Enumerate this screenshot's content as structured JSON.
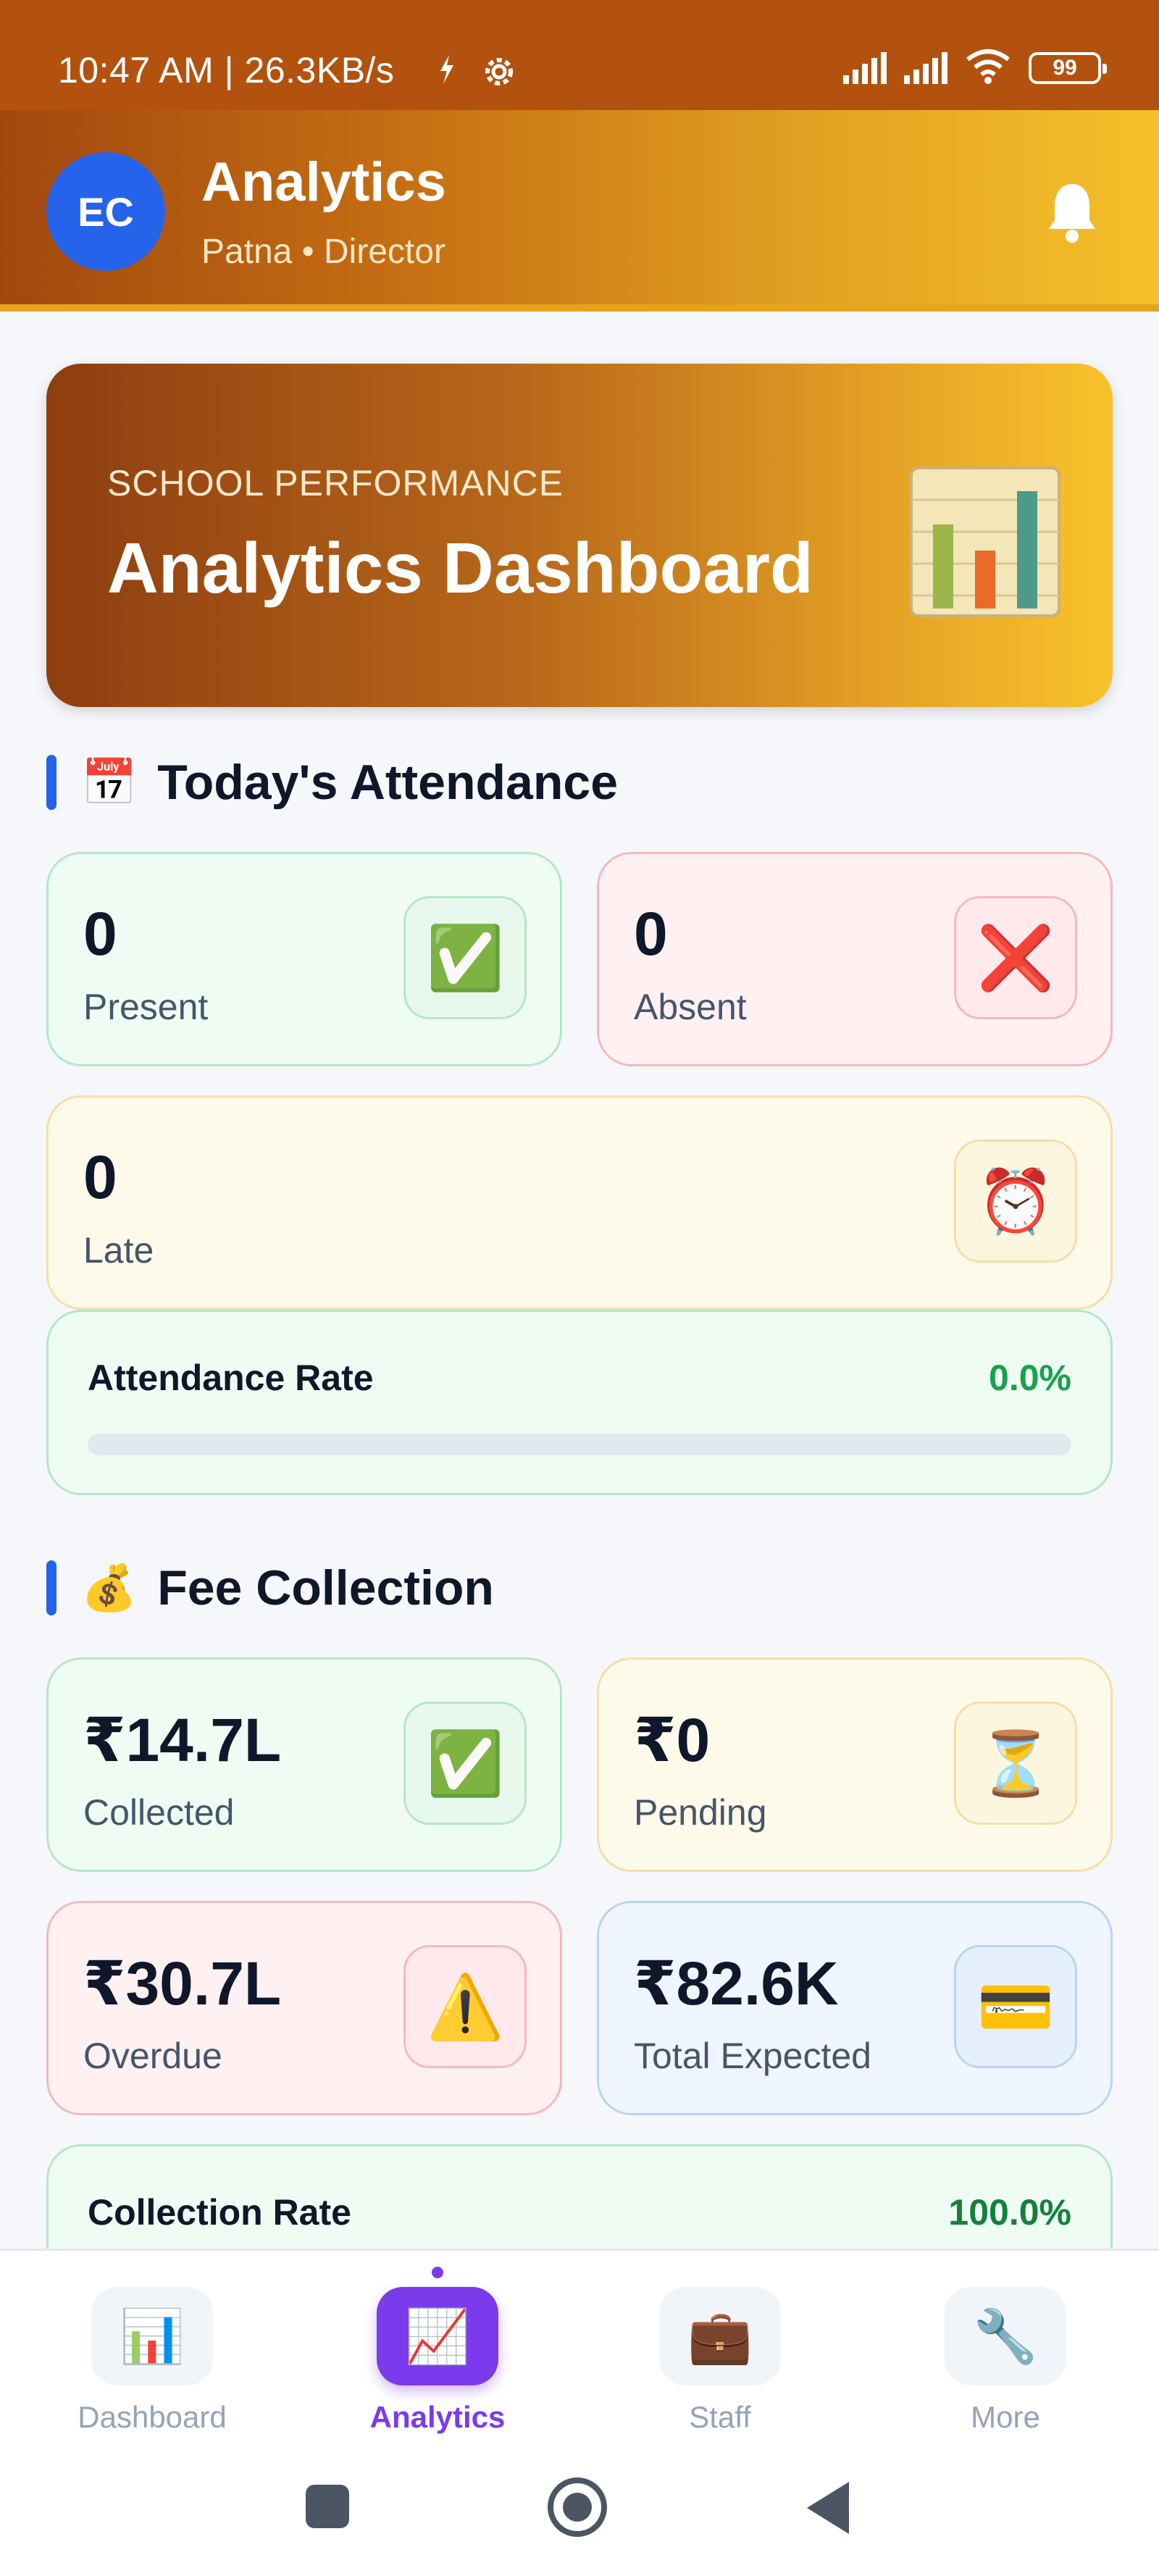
{
  "status_bar": {
    "time": "10:47 AM | 26.3KB/s",
    "battery": "99"
  },
  "header": {
    "avatar_initials": "EC",
    "title": "Analytics",
    "subtitle": "Patna • Director"
  },
  "hero": {
    "kicker": "SCHOOL PERFORMANCE",
    "title": "Analytics Dashboard"
  },
  "attendance": {
    "title": "Today's Attendance",
    "emoji": "📅",
    "present": {
      "value": "0",
      "label": "Present",
      "icon": "✅"
    },
    "absent": {
      "value": "0",
      "label": "Absent",
      "icon": "❌"
    },
    "late": {
      "value": "0",
      "label": "Late",
      "icon": "⏰"
    },
    "rate": {
      "label": "Attendance Rate",
      "value": "0.0%",
      "percent": 0
    }
  },
  "fees": {
    "title": "Fee Collection",
    "emoji": "💰",
    "collected": {
      "value": "₹14.7L",
      "label": "Collected",
      "icon": "✅"
    },
    "pending": {
      "value": "₹0",
      "label": "Pending",
      "icon": "⏳"
    },
    "overdue": {
      "value": "₹30.7L",
      "label": "Overdue",
      "icon": "⚠️"
    },
    "expected": {
      "value": "₹82.6K",
      "label": "Total Expected",
      "icon": "💳"
    },
    "rate": {
      "label": "Collection Rate",
      "value": "100.0%",
      "percent": 100
    }
  },
  "nav": {
    "items": [
      {
        "label": "Dashboard",
        "icon": "📊"
      },
      {
        "label": "Analytics",
        "icon": "📈"
      },
      {
        "label": "Staff",
        "icon": "💼"
      },
      {
        "label": "More",
        "icon": "🔧"
      }
    ],
    "active": "Analytics"
  },
  "colors": {
    "accent": "#7c3aed",
    "header": "#b2520e",
    "success": "#16a34a",
    "brand_blue": "#2563eb"
  }
}
